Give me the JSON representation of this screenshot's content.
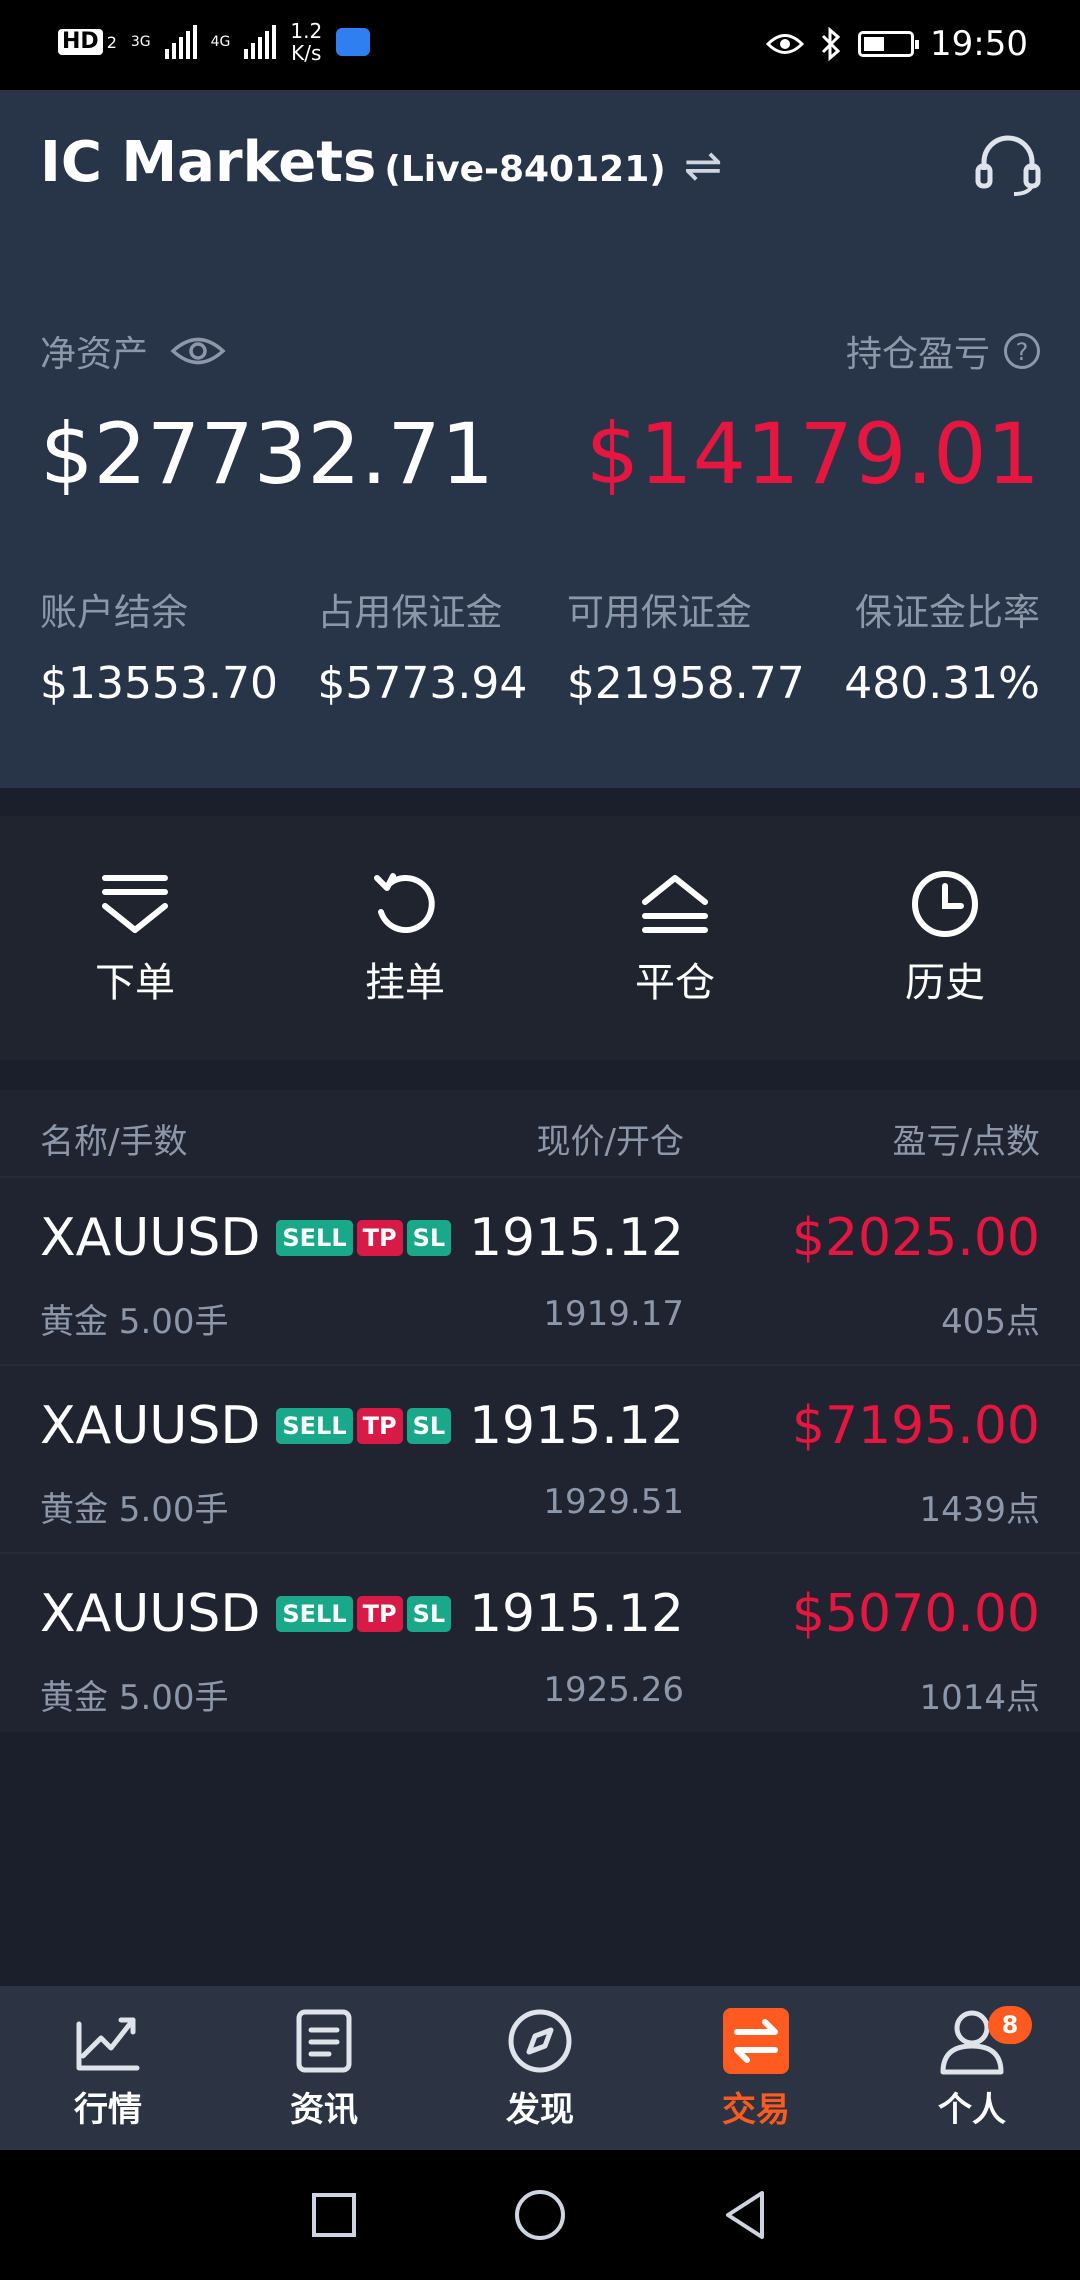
{
  "status_bar": {
    "hd": "HD",
    "hd_sub": "2",
    "sig1": "3G",
    "sig2": "4G",
    "speed_value": "1.2",
    "speed_unit": "K/s",
    "time": "19:50",
    "battery_level": 0.45
  },
  "header": {
    "brand": "IC Markets",
    "account": "(Live-840121)"
  },
  "summary": {
    "equity_label": "净资产",
    "equity_value": "$27732.71",
    "pl_label": "持仓盈亏",
    "pl_value": "$14179.01",
    "stats": [
      {
        "label": "账户结余",
        "value": "$13553.70"
      },
      {
        "label": "占用保证金",
        "value": "$5773.94"
      },
      {
        "label": "可用保证金",
        "value": "$21958.77"
      },
      {
        "label": "保证金比率",
        "value": "480.31%"
      }
    ]
  },
  "actions": [
    {
      "label": "下单",
      "icon": "order-icon"
    },
    {
      "label": "挂单",
      "icon": "pending-order-icon"
    },
    {
      "label": "平仓",
      "icon": "close-position-icon"
    },
    {
      "label": "历史",
      "icon": "history-icon"
    }
  ],
  "positions": {
    "headers": {
      "name": "名称/手数",
      "price": "现价/开仓",
      "pl": "盈亏/点数"
    },
    "tags": {
      "sell": "SELL",
      "tp": "TP",
      "sl": "SL"
    },
    "rows": [
      {
        "symbol": "XAUUSD",
        "desc": "黄金 5.00手",
        "price": "1915.12",
        "open": "1919.17",
        "pl": "$2025.00",
        "points": "405点"
      },
      {
        "symbol": "XAUUSD",
        "desc": "黄金 5.00手",
        "price": "1915.12",
        "open": "1929.51",
        "pl": "$7195.00",
        "points": "1439点"
      },
      {
        "symbol": "XAUUSD",
        "desc": "黄金 5.00手",
        "price": "1915.12",
        "open": "1925.26",
        "pl": "$5070.00",
        "points": "1014点"
      }
    ]
  },
  "bottom_nav": {
    "items": [
      {
        "label": "行情",
        "icon": "market-chart-icon"
      },
      {
        "label": "资讯",
        "icon": "news-icon"
      },
      {
        "label": "发现",
        "icon": "compass-icon"
      },
      {
        "label": "交易",
        "icon": "trade-icon",
        "active": true
      },
      {
        "label": "个人",
        "icon": "profile-icon",
        "badge": "8"
      }
    ]
  },
  "colors": {
    "accent": "#ff5a1f",
    "loss_red": "#e5163f",
    "tag_green": "#1aa88a",
    "header_bg": "#283448"
  }
}
